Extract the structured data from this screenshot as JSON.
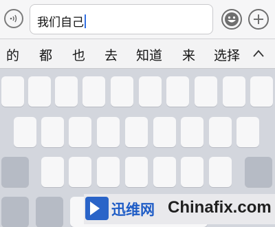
{
  "input": {
    "text": "我们自己"
  },
  "candidates": [
    "的",
    "都",
    "也",
    "去",
    "知道",
    "来",
    "选择"
  ],
  "icons": {
    "voice": "voice-input-icon",
    "emoji": "emoji-face-icon",
    "plus": "plus-icon",
    "collapse": "chevron-up-icon",
    "logo": "play-triangle-logo-icon"
  },
  "watermark": {
    "cn": "迅维网",
    "en": "Chinafix.com"
  },
  "colors": {
    "key": "#f7f7f8",
    "function_key": "#b6bbc5",
    "keyboard_bg": "#d3d6dd",
    "brand_blue": "#1e5cc6",
    "caret": "#2f6de1"
  }
}
